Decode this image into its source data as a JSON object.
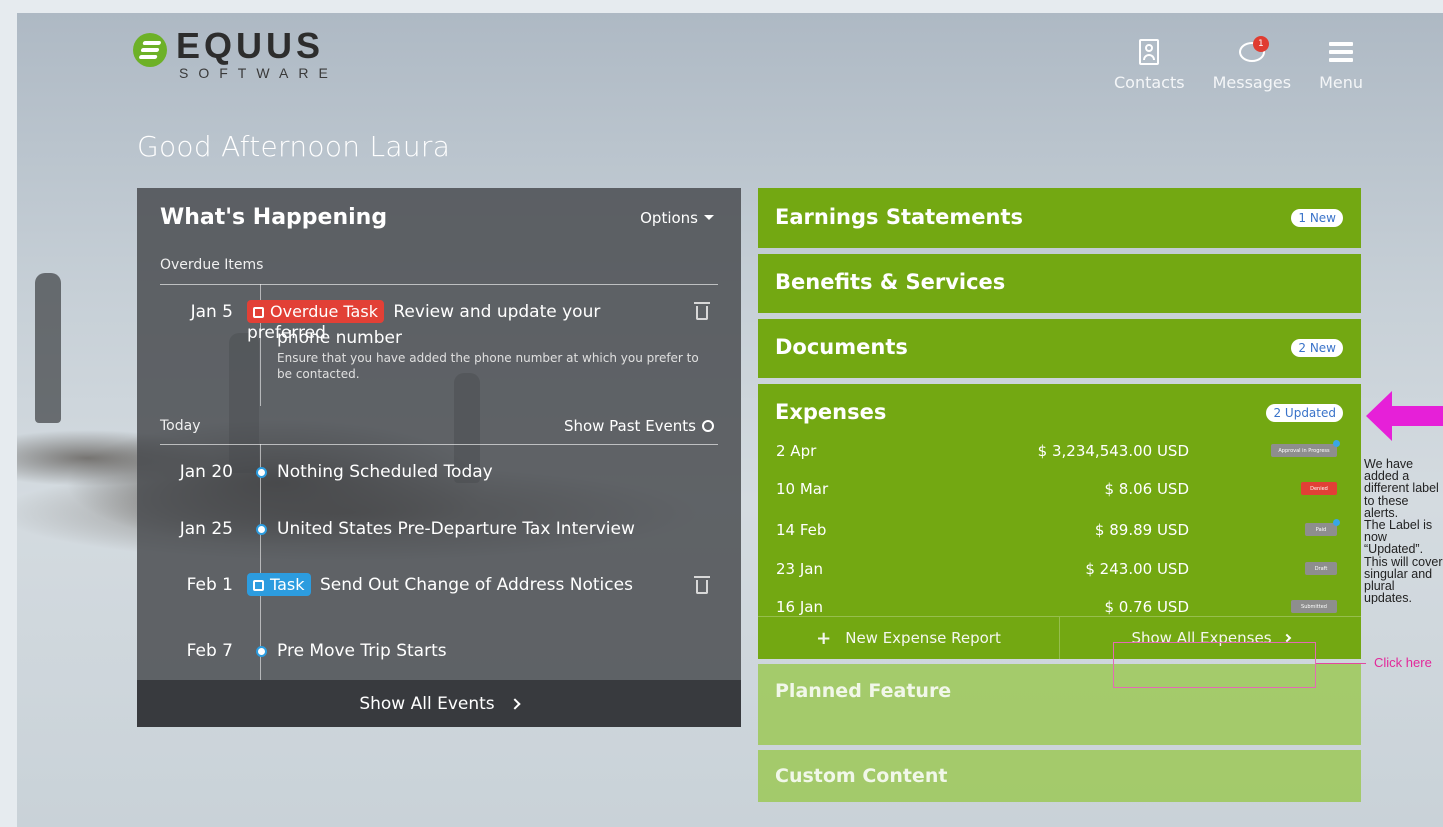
{
  "brand": {
    "name": "EQUUS",
    "sub": "SOFTWARE",
    "color": "#6db127"
  },
  "topnav": {
    "contacts": "Contacts",
    "messages": "Messages",
    "messages_badge": "1",
    "menu": "Menu"
  },
  "greeting": "Good Afternoon Laura",
  "whats_happening": {
    "title": "What's Happening",
    "options": "Options",
    "overdue_label": "Overdue Items",
    "overdue": {
      "date": "Jan 5",
      "tag": "Overdue Task",
      "title_line1": "Review and update your preferred",
      "title_line2": "phone number",
      "desc": "Ensure that you have added the phone number at which you prefer to be contacted."
    },
    "today_label": "Today",
    "show_past": "Show Past Events",
    "events": [
      {
        "date": "Jan 20",
        "text": "Nothing Scheduled Today"
      },
      {
        "date": "Jan 25",
        "text": "United States Pre-Departure Tax Interview"
      },
      {
        "date": "Feb 1",
        "tag": "Task",
        "text": "Send Out Change of Address Notices"
      },
      {
        "date": "Feb 7",
        "text": "Pre Move Trip Starts"
      }
    ],
    "show_all": "Show All Events"
  },
  "tiles": {
    "earnings": {
      "title": "Earnings Statements",
      "badge": "1 New"
    },
    "benefits": {
      "title": "Benefits & Services"
    },
    "documents": {
      "title": "Documents",
      "badge": "2 New"
    },
    "expenses": {
      "title": "Expenses",
      "badge": "2 Updated",
      "rows": [
        {
          "date": "2 Apr",
          "amount": "$ 3,234,543.00 USD",
          "status": "Approval in Progress",
          "status_color": "#8e8e8e",
          "updated": true
        },
        {
          "date": "10 Mar",
          "amount": "$ 8.06 USD",
          "status": "Denied",
          "status_color": "#e24036",
          "updated": false
        },
        {
          "date": "14 Feb",
          "amount": "$ 89.89 USD",
          "status": "Paid",
          "status_color": "#8e8e8e",
          "updated": true
        },
        {
          "date": "23 Jan",
          "amount": "$ 243.00 USD",
          "status": "Draft",
          "status_color": "#8e8e8e",
          "updated": false
        },
        {
          "date": "16 Jan",
          "amount": "$ 0.76 USD",
          "status": "Submitted",
          "status_color": "#8e8e8e",
          "updated": false
        }
      ],
      "new_report": "New Expense Report",
      "show_all": "Show All Expenses"
    },
    "planned": {
      "title": "Planned Feature"
    },
    "custom": {
      "title": "Custom Content"
    }
  },
  "annotation": {
    "note": "We have\nadded a\ndifferent label\nto these alerts.\nThe Label is\nnow\n“Updated”.\nThis will cover\nsingular and\nplural updates.",
    "click_here": "Click here",
    "color": "#e2289a"
  }
}
